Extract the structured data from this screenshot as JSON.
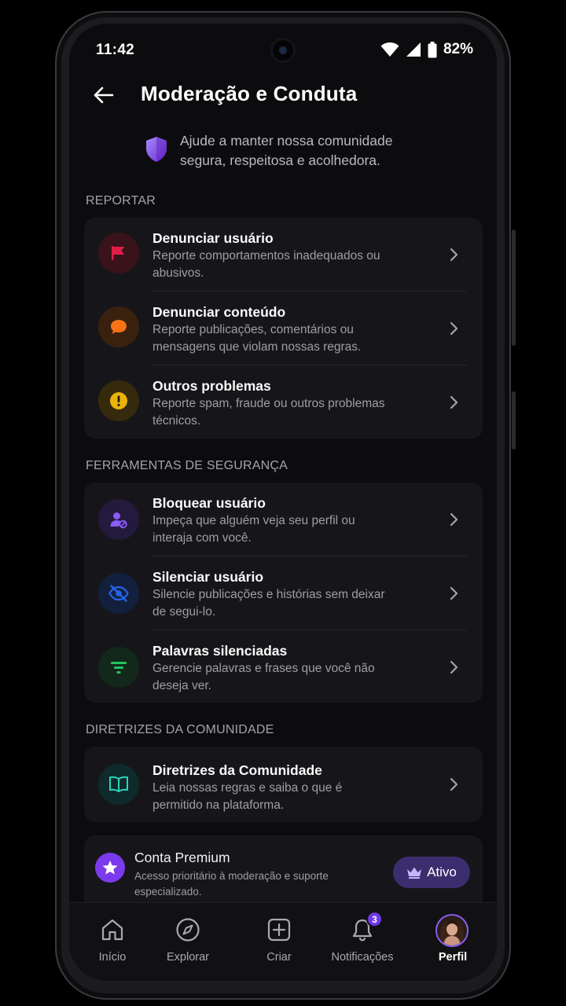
{
  "status_bar": {
    "time": "11:42",
    "battery": "82%"
  },
  "header": {
    "title": "Moderação e Conduta"
  },
  "intro": {
    "text": "Ajude a manter nossa comunidade segura, respeitosa e acolhedora."
  },
  "sections": {
    "report": {
      "label": "REPORTAR",
      "items": [
        {
          "title": "Denunciar usuário",
          "desc": "Reporte comportamentos inadequados ou abusivos.",
          "icon": "flag-icon",
          "color": "#e11d48"
        },
        {
          "title": "Denunciar conteúdo",
          "desc": "Reporte publicações, comentários ou mensagens que violam nossas regras.",
          "icon": "chat-bubble-icon",
          "color": "#f97316"
        },
        {
          "title": "Outros problemas",
          "desc": "Reporte spam, fraude ou outros problemas técnicos.",
          "icon": "warning-icon",
          "color": "#eab308"
        }
      ]
    },
    "safety": {
      "label": "FERRAMENTAS DE SEGURANÇA",
      "items": [
        {
          "title": "Bloquear usuário",
          "desc": "Impeça que alguém veja seu perfil ou interaja com você.",
          "icon": "block-user-icon",
          "color": "#8b5cf6"
        },
        {
          "title": "Silenciar usuário",
          "desc": "Silencie publicações e histórias sem deixar de segui-lo.",
          "icon": "eye-off-icon",
          "color": "#2563eb"
        },
        {
          "title": "Palavras silenciadas",
          "desc": "Gerencie palavras e frases que você não deseja ver.",
          "icon": "filter-icon",
          "color": "#22c55e"
        }
      ]
    },
    "guidelines": {
      "label": "DIRETRIZES DA COMUNIDADE",
      "items": [
        {
          "title": "Diretrizes da Comunidade",
          "desc": "Leia nossas regras e saiba o que é permitido na plataforma.",
          "icon": "book-icon",
          "color": "#2dd4bf"
        }
      ]
    }
  },
  "premium": {
    "title": "Conta Premium",
    "desc": "Acesso prioritário à moderação e suporte especializado.",
    "status": "Ativo",
    "accent": "#7c3aed"
  },
  "nav": {
    "items": [
      {
        "label": "Início",
        "icon": "home-icon"
      },
      {
        "label": "Explorar",
        "icon": "compass-icon"
      },
      {
        "label": "Criar",
        "icon": "plus-square-icon"
      },
      {
        "label": "Notificações",
        "icon": "bell-icon",
        "badge": "3"
      },
      {
        "label": "Perfil",
        "icon": "avatar",
        "active": true
      }
    ]
  }
}
